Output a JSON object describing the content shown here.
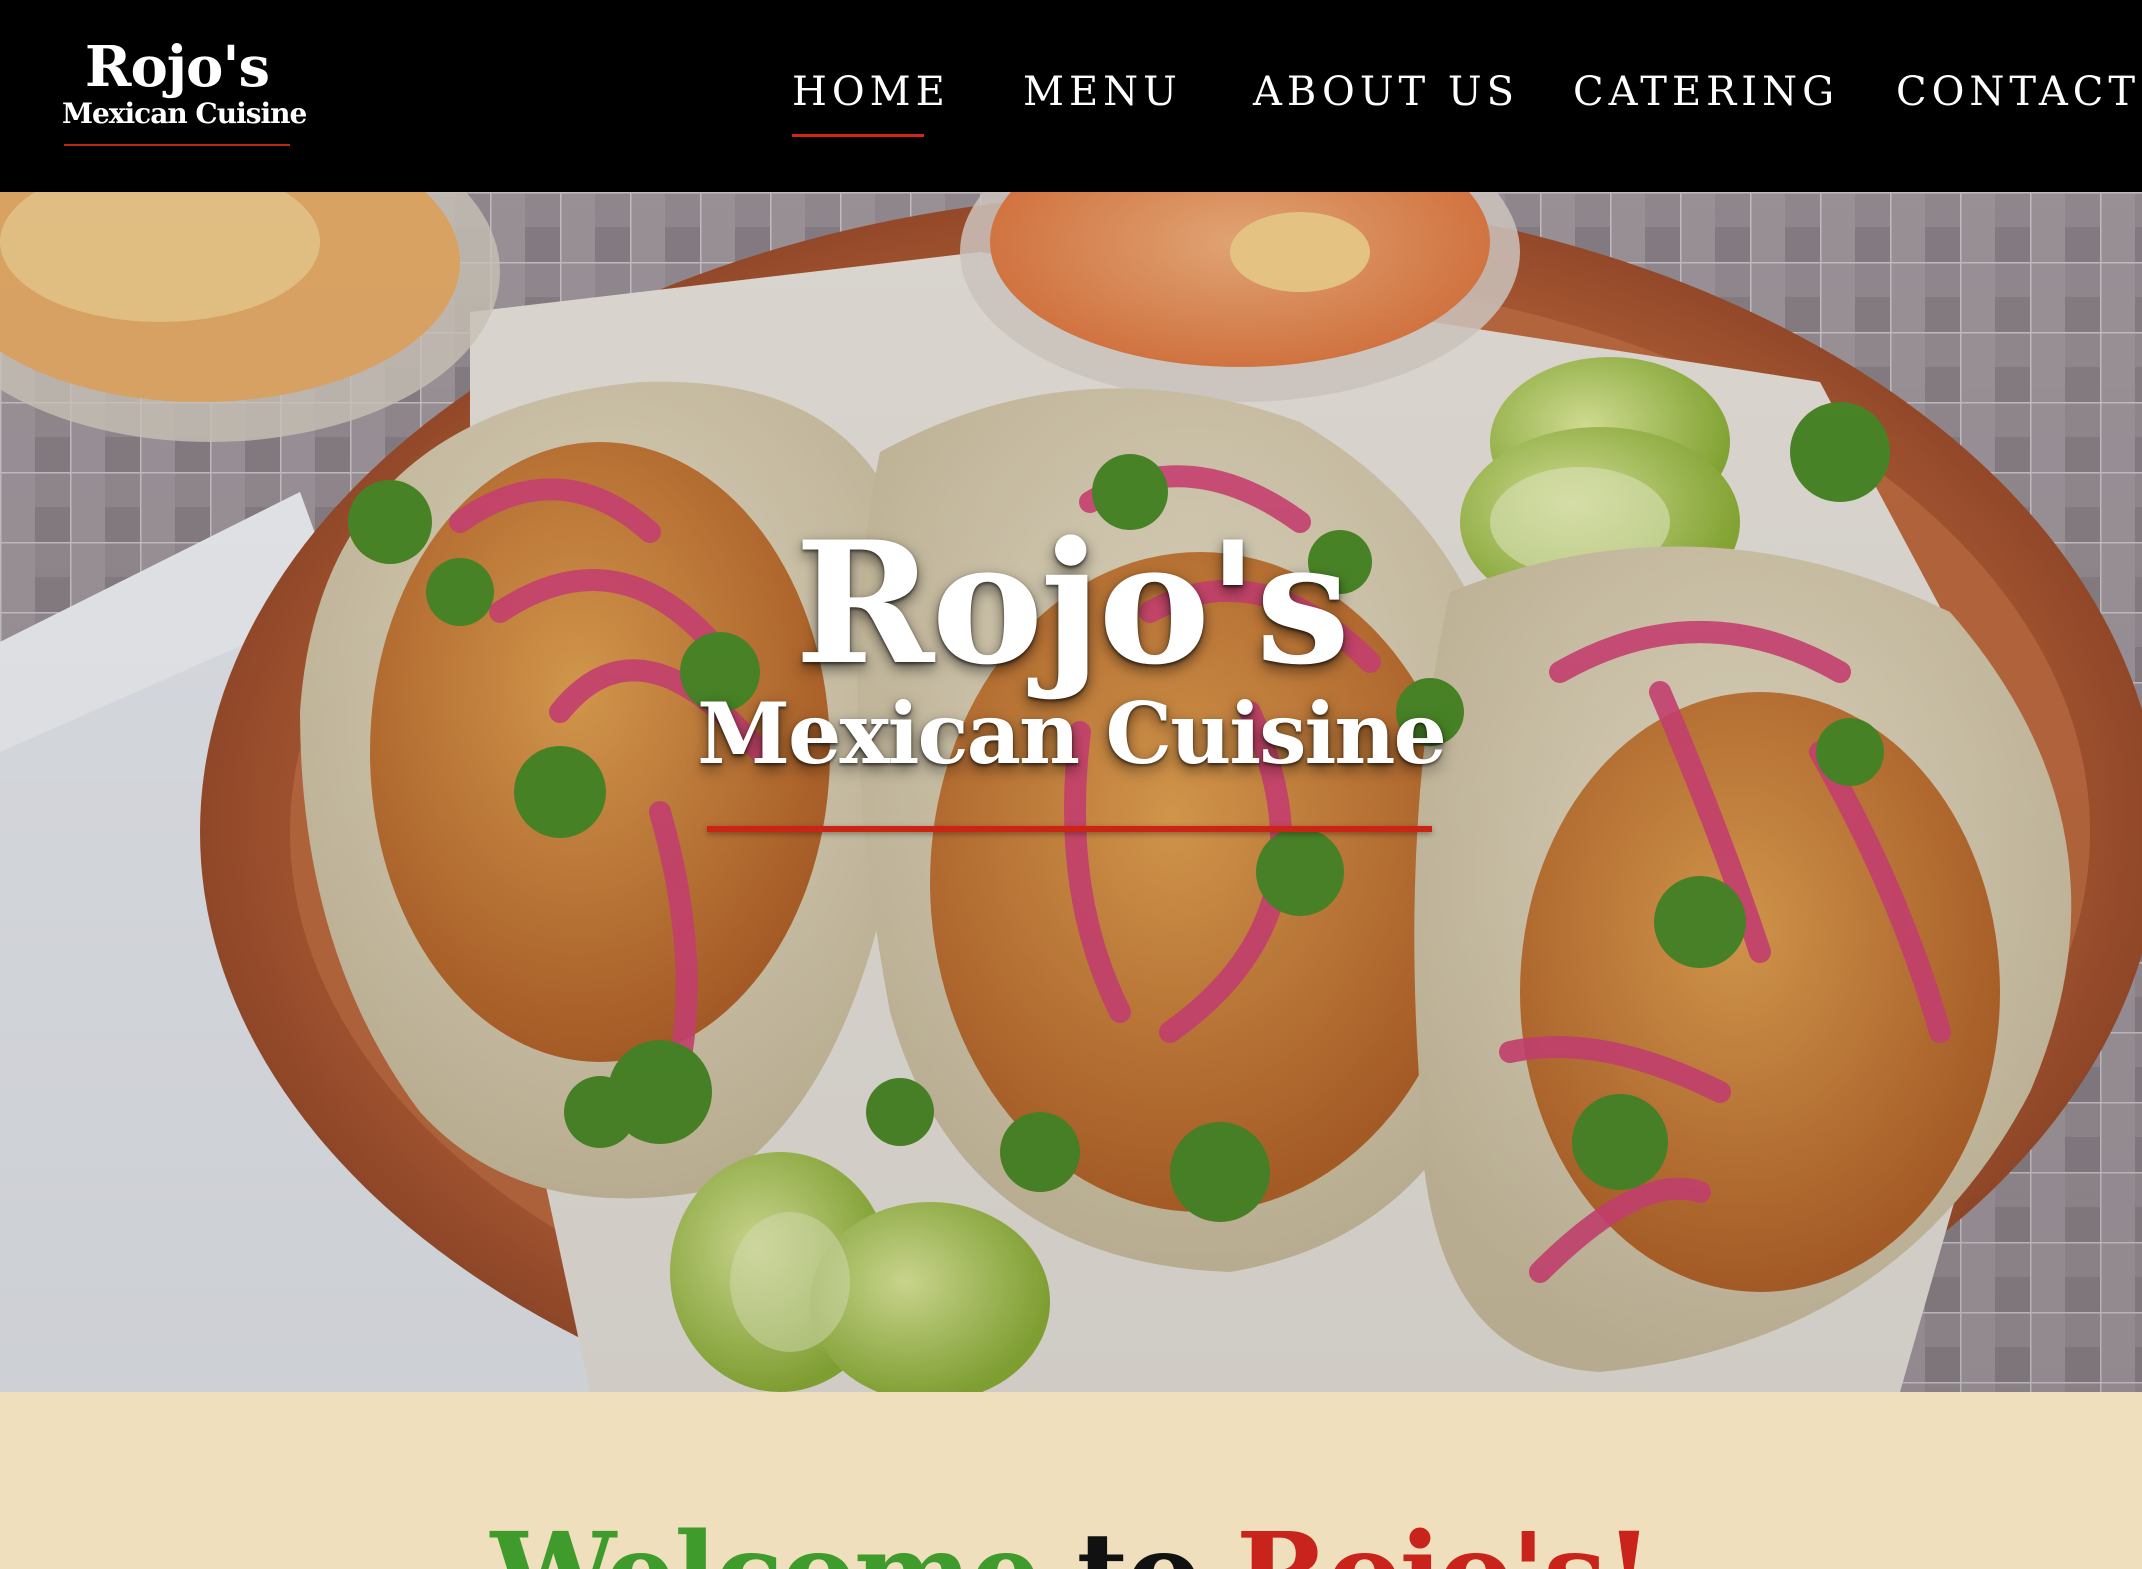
{
  "header": {
    "logo": {
      "name": "Rojo's",
      "subtitle": "Mexican Cuisine"
    },
    "nav": [
      {
        "label": "HOME",
        "active": true
      },
      {
        "label": "MENU",
        "active": false
      },
      {
        "label": "ABOUT US",
        "active": false
      },
      {
        "label": "CATERING",
        "active": false
      },
      {
        "label": "CONTACT",
        "active": false
      }
    ]
  },
  "hero": {
    "title": "Rojo's",
    "subtitle": "Mexican Cuisine",
    "image_subject": "fish-tacos-photo"
  },
  "welcome": {
    "word1": "Welcome",
    "word2": "to",
    "word3": "Rojo's!"
  },
  "colors": {
    "header_bg": "#000000",
    "accent_red": "#cc2414",
    "welcome_bg": "#efdfbd",
    "welcome_green": "#3f9b2c",
    "welcome_red": "#c8241b"
  }
}
